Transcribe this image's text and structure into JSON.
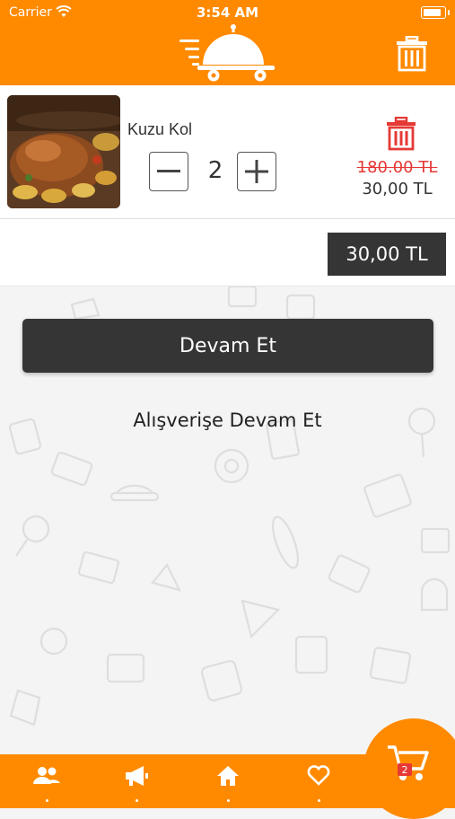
{
  "status_bar": {
    "carrier": "Carrier",
    "time": "3:54 AM"
  },
  "cart_item": {
    "name": "Kuzu Kol",
    "quantity": "2",
    "old_price": "180.00 TL",
    "price": "30,00 TL"
  },
  "total": "30,00 TL",
  "actions": {
    "continue_label": "Devam Et",
    "shopping_label": "Alışverişe Devam Et"
  },
  "bottom_nav": {
    "cart_count": "2",
    "items": [
      "people-icon",
      "megaphone-icon",
      "home-icon",
      "heart-icon",
      "cart-icon"
    ]
  },
  "colors": {
    "brand": "#ff8a00",
    "dark": "#353535",
    "delete": "#e53935"
  }
}
